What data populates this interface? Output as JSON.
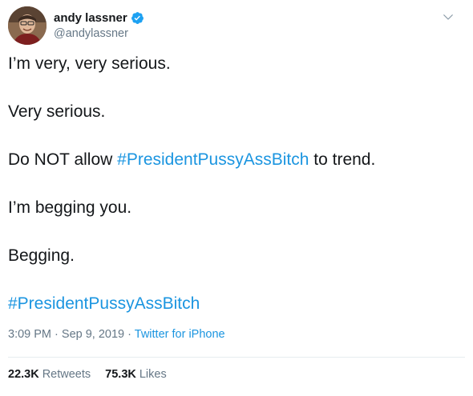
{
  "user": {
    "display_name": "andy lassner",
    "handle": "@andylassner",
    "verified_icon": "verified-badge-icon"
  },
  "tweet": {
    "lines": [
      {
        "text": "I’m very, very serious."
      },
      {
        "text": "Very serious."
      },
      {
        "before": "Do NOT allow ",
        "hashtag": "#PresidentPussyAssBitch",
        "after": " to trend."
      },
      {
        "text": "I’m begging you."
      },
      {
        "text": "Begging."
      },
      {
        "hashtag": "#PresidentPussyAssBitch"
      }
    ],
    "time": "3:09 PM",
    "date": "Sep 9, 2019",
    "separator": "·",
    "source": "Twitter for iPhone"
  },
  "stats": {
    "retweets_count": "22.3K",
    "retweets_label": "Retweets",
    "likes_count": "75.3K",
    "likes_label": "Likes"
  },
  "colors": {
    "link": "#1b95e0",
    "muted": "#657786",
    "text": "#14171a",
    "divider": "#e6ecf0"
  }
}
